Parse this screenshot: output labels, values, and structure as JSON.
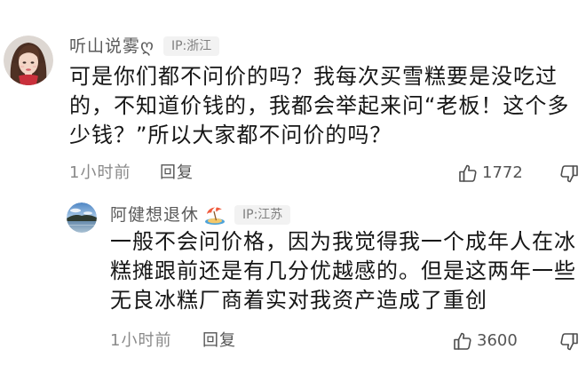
{
  "comment": {
    "username": "听山说雾ღ",
    "ip_location": "IP:浙江",
    "text": "可是你们都不问价的吗？我每次买雪糕要是没吃过的，不知道价钱的，我都会举起来问“老板！这个多少钱？”所以大家都不问价的吗？",
    "time": "1小时前",
    "reply_label": "回复",
    "like_count": "1772",
    "avatar_icon": "girl-photo-avatar",
    "like_icon": "thumbs-up-icon",
    "dislike_icon": "thumbs-down-icon"
  },
  "reply": {
    "username": "阿健想退休",
    "username_emoji_icon": "beach-umbrella-icon",
    "ip_location": "IP:江苏",
    "text": "一般不会问价格，因为我觉得我一个成年人在冰糕摊跟前还是有几分优越感的。但是这两年一些无良冰糕厂商着实对我资产造成了重创",
    "time": "1小时前",
    "reply_label": "回复",
    "like_count": "3600",
    "avatar_icon": "landscape-photo-avatar",
    "like_icon": "thumbs-up-icon",
    "dislike_icon": "thumbs-down-icon"
  },
  "colors": {
    "background": "#ffffff",
    "text_primary": "#161616",
    "text_secondary": "#8a8a8a",
    "username": "#5a5a5a",
    "badge_background": "#f2f2f2"
  }
}
